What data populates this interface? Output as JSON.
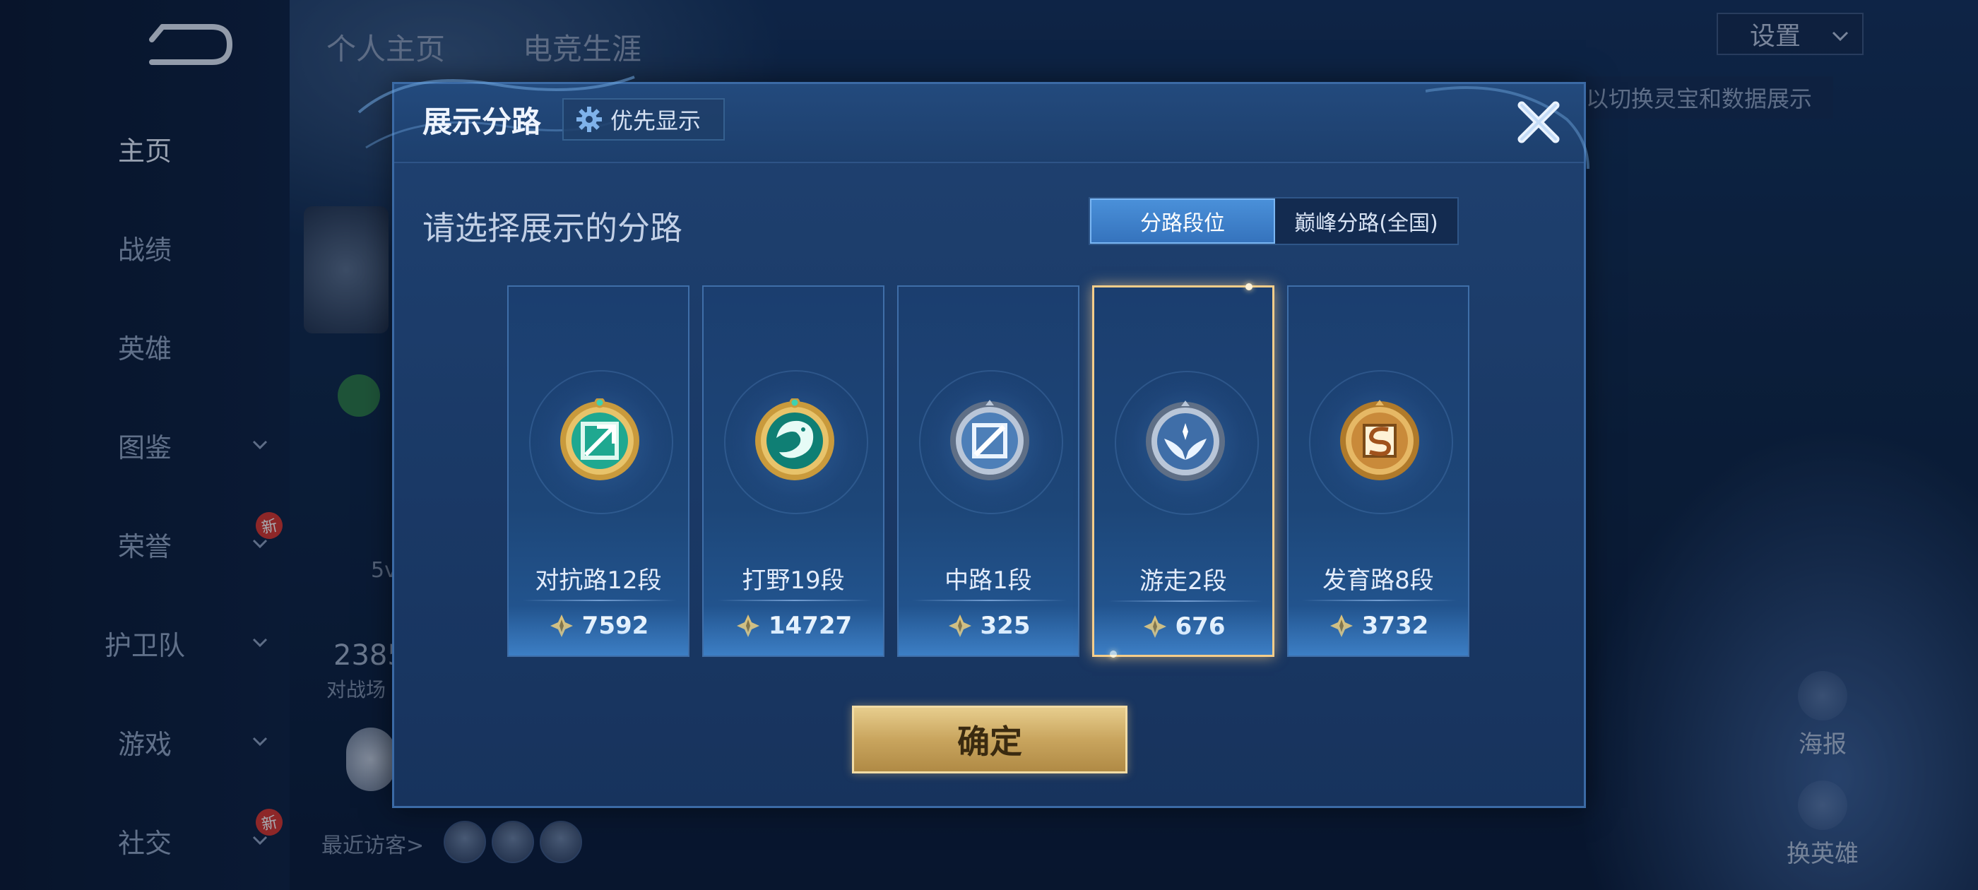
{
  "sidebar": {
    "items": [
      {
        "label": "主页",
        "active": true,
        "chevron": false,
        "badge": ""
      },
      {
        "label": "战绩",
        "active": false,
        "chevron": false,
        "badge": ""
      },
      {
        "label": "英雄",
        "active": false,
        "chevron": false,
        "badge": ""
      },
      {
        "label": "图鉴",
        "active": false,
        "chevron": true,
        "badge": ""
      },
      {
        "label": "荣誉",
        "active": false,
        "chevron": true,
        "badge": "新"
      },
      {
        "label": "护卫队",
        "active": false,
        "chevron": true,
        "badge": ""
      },
      {
        "label": "游戏",
        "active": false,
        "chevron": true,
        "badge": ""
      },
      {
        "label": "社交",
        "active": false,
        "chevron": true,
        "badge": "新"
      }
    ]
  },
  "background": {
    "tabs": [
      "个人主页",
      "电竞生涯"
    ],
    "settings_label": "设置",
    "hint_text": "以切换灵宝和数据展示",
    "partial_5v": "5v",
    "partial_number": "2385",
    "partial_label": "对战场",
    "recent_visitors_label": "最近访客>",
    "actions": [
      "海报",
      "换英雄"
    ]
  },
  "modal": {
    "title": "展示分路",
    "priority_label": "优先显示",
    "prompt": "请选择展示的分路",
    "toggle": {
      "active": "分路段位",
      "inactive": "巅峰分路(全国)"
    },
    "lanes": [
      {
        "label": "对抗路12段",
        "score": "7592",
        "icon": "clash-lane-emblem",
        "selected": false
      },
      {
        "label": "打野19段",
        "score": "14727",
        "icon": "jungle-dragon-emblem",
        "selected": false
      },
      {
        "label": "中路1段",
        "score": "325",
        "icon": "mid-lane-emblem",
        "selected": false
      },
      {
        "label": "游走2段",
        "score": "676",
        "icon": "roam-wings-emblem",
        "selected": true
      },
      {
        "label": "发育路8段",
        "score": "3732",
        "icon": "farm-lane-emblem",
        "selected": false
      }
    ],
    "confirm_label": "确定"
  },
  "colors": {
    "accent_blue": "#4a90d9",
    "gold": "#c9a55e",
    "selected_border": "#f5cd8a"
  }
}
